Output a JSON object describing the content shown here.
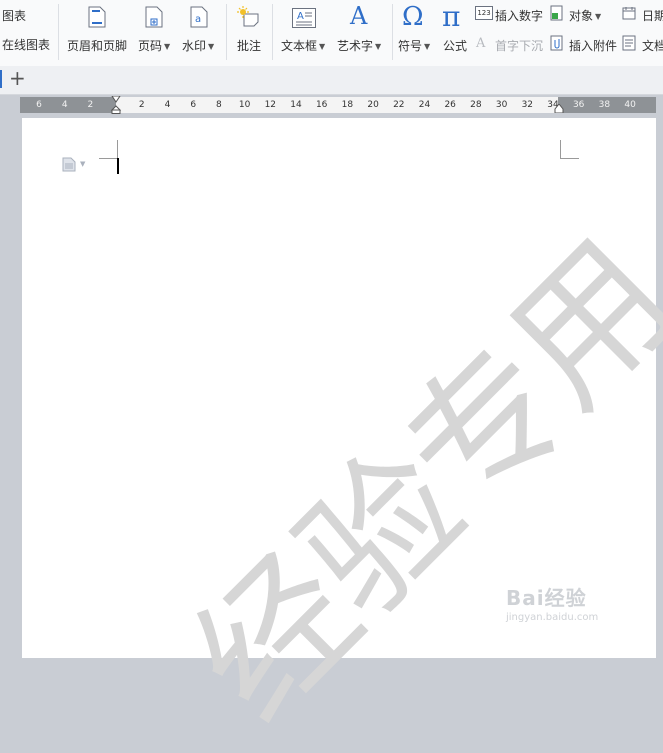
{
  "ribbon": {
    "chart_label": "图表",
    "online_chart_label": "在线图表",
    "header_footer_label": "页眉和页脚",
    "page_number_label": "页码",
    "watermark_label": "水印",
    "comment_label": "批注",
    "textbox_label": "文本框",
    "wordart_label": "艺术字",
    "symbol_label": "符号",
    "formula_label": "公式",
    "insert_number_label": "插入数字",
    "dropcap_label": "首字下沉",
    "object_label": "对象",
    "attachment_label": "插入附件",
    "date_label": "日期",
    "document_label": "文档",
    "number_icon_text": "123"
  },
  "tabs": {
    "new_tab_label": "+"
  },
  "ruler": {
    "ticks": [
      "6",
      "4",
      "2",
      "2",
      "4",
      "6",
      "8",
      "10",
      "12",
      "14",
      "16",
      "18",
      "20",
      "22",
      "24",
      "26",
      "28",
      "30",
      "32",
      "34",
      "36",
      "38",
      "40"
    ]
  },
  "page": {
    "watermark_text": "经验专用"
  },
  "brand": {
    "line1": "Bai经验",
    "line2": "jingyan.baidu.com"
  },
  "colors": {
    "accent_blue": "#2f6ec8",
    "watermark": "#d6d6d6",
    "ruler_dark": "#8e9296"
  }
}
